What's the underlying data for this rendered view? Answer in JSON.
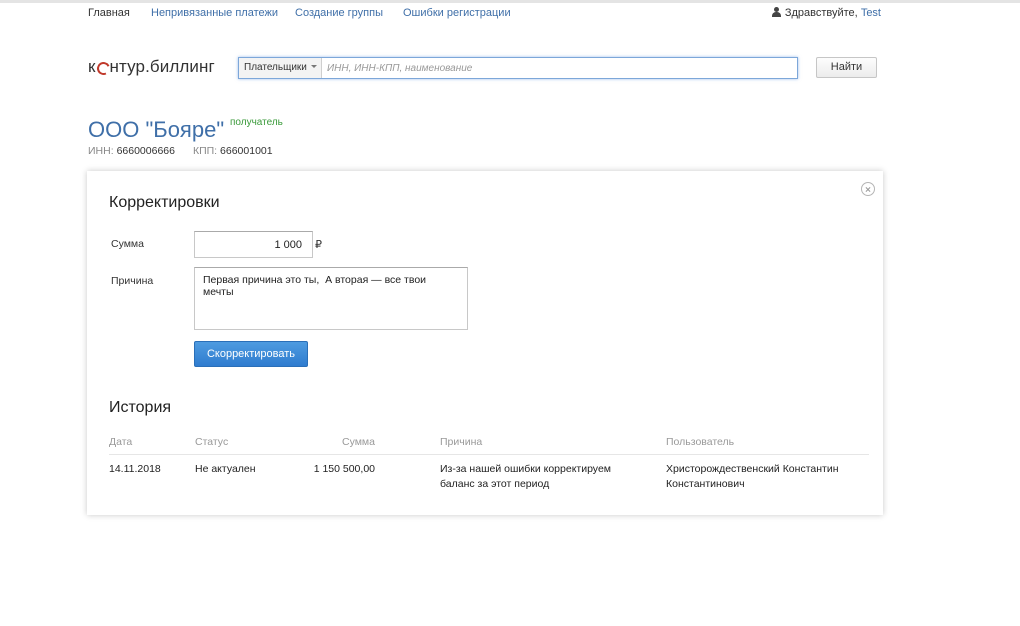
{
  "nav": {
    "items": [
      {
        "label": "Главная",
        "current": true
      },
      {
        "label": "Непривязанные платежи",
        "current": false
      },
      {
        "label": "Создание группы",
        "current": false
      },
      {
        "label": "Ошибки регистрации",
        "current": false
      }
    ],
    "greeting": "Здравствуйте,",
    "username": "Test"
  },
  "logo": {
    "part1": "к",
    "part2": "нтур.биллинг"
  },
  "search": {
    "type_label": "Плательщики",
    "placeholder": "ИНН, ИНН-КПП, наименование",
    "value": "",
    "button_label": "Найти"
  },
  "org": {
    "name": "ООО \"Бояре\"",
    "role": "получатель",
    "inn_label": "ИНН:",
    "inn": "6660006666",
    "kpp_label": "КПП:",
    "kpp": "666001001"
  },
  "corrections": {
    "title": "Корректировки",
    "sum_label": "Сумма",
    "sum_value": "1 000",
    "currency": "₽",
    "reason_label": "Причина",
    "reason_value": "Первая причина это ты,  А вторая — все твои мечты",
    "submit_label": "Скорректировать"
  },
  "history": {
    "title": "История",
    "columns": [
      "Дата",
      "Статус",
      "Сумма",
      "Причина",
      "Пользователь"
    ],
    "rows": [
      {
        "date": "14.11.2018",
        "status": "Не актуален",
        "sum": "1 150 500,00",
        "reason": "Из-за нашей ошибки корректируем баланс за этот период",
        "user": "Христорождественский Константин Константинович"
      }
    ]
  },
  "colors": {
    "link": "#3f6fa8",
    "role_green": "#3a9a3a",
    "button_blue": "#2f7ccf",
    "logo_accent": "#c0392b"
  }
}
